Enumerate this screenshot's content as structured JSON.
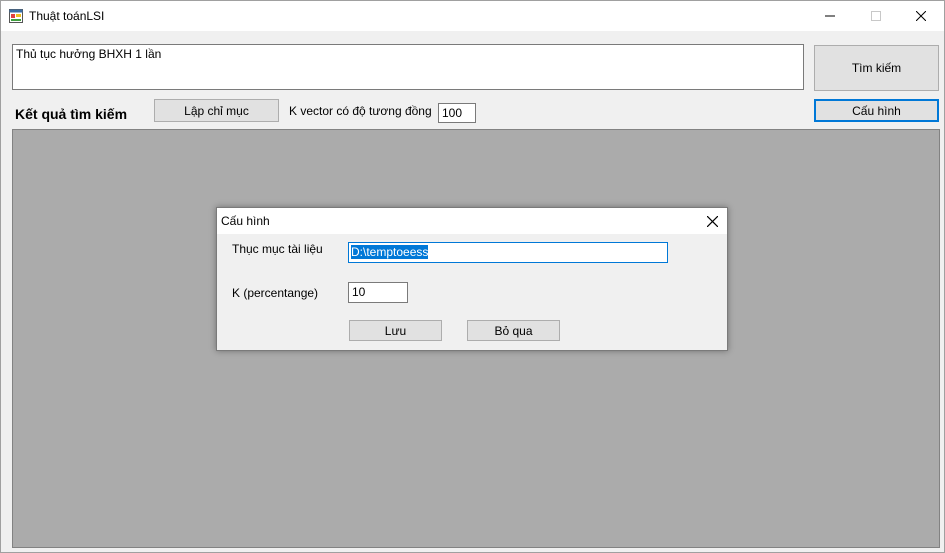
{
  "window": {
    "title": "Thuật toánLSI",
    "icon": "app-window-icon",
    "controls": [
      "minimize-icon",
      "maximize-icon",
      "close-icon"
    ]
  },
  "search": {
    "query": "Thủ tục hưởng BHXH 1 lần",
    "search_button": "Tìm kiếm",
    "config_button": "Cấu hình"
  },
  "toolbar": {
    "results_heading": "Kết quả tìm kiếm",
    "index_button": "Lập chỉ mục",
    "k_vector_label": "K vector có độ tương đồng",
    "k_vector_value": "100"
  },
  "dialog": {
    "title": "Cấu hình",
    "folder_label": "Thục mục tài liệu",
    "folder_value": "D:\\temptoeess",
    "k_label": "K (percentange)",
    "k_value": "10",
    "save_button": "Lưu",
    "cancel_button": "Bỏ qua"
  },
  "colors": {
    "accent": "#0078d7",
    "results_bg": "#ababab",
    "window_bg": "#f0f0f0"
  }
}
